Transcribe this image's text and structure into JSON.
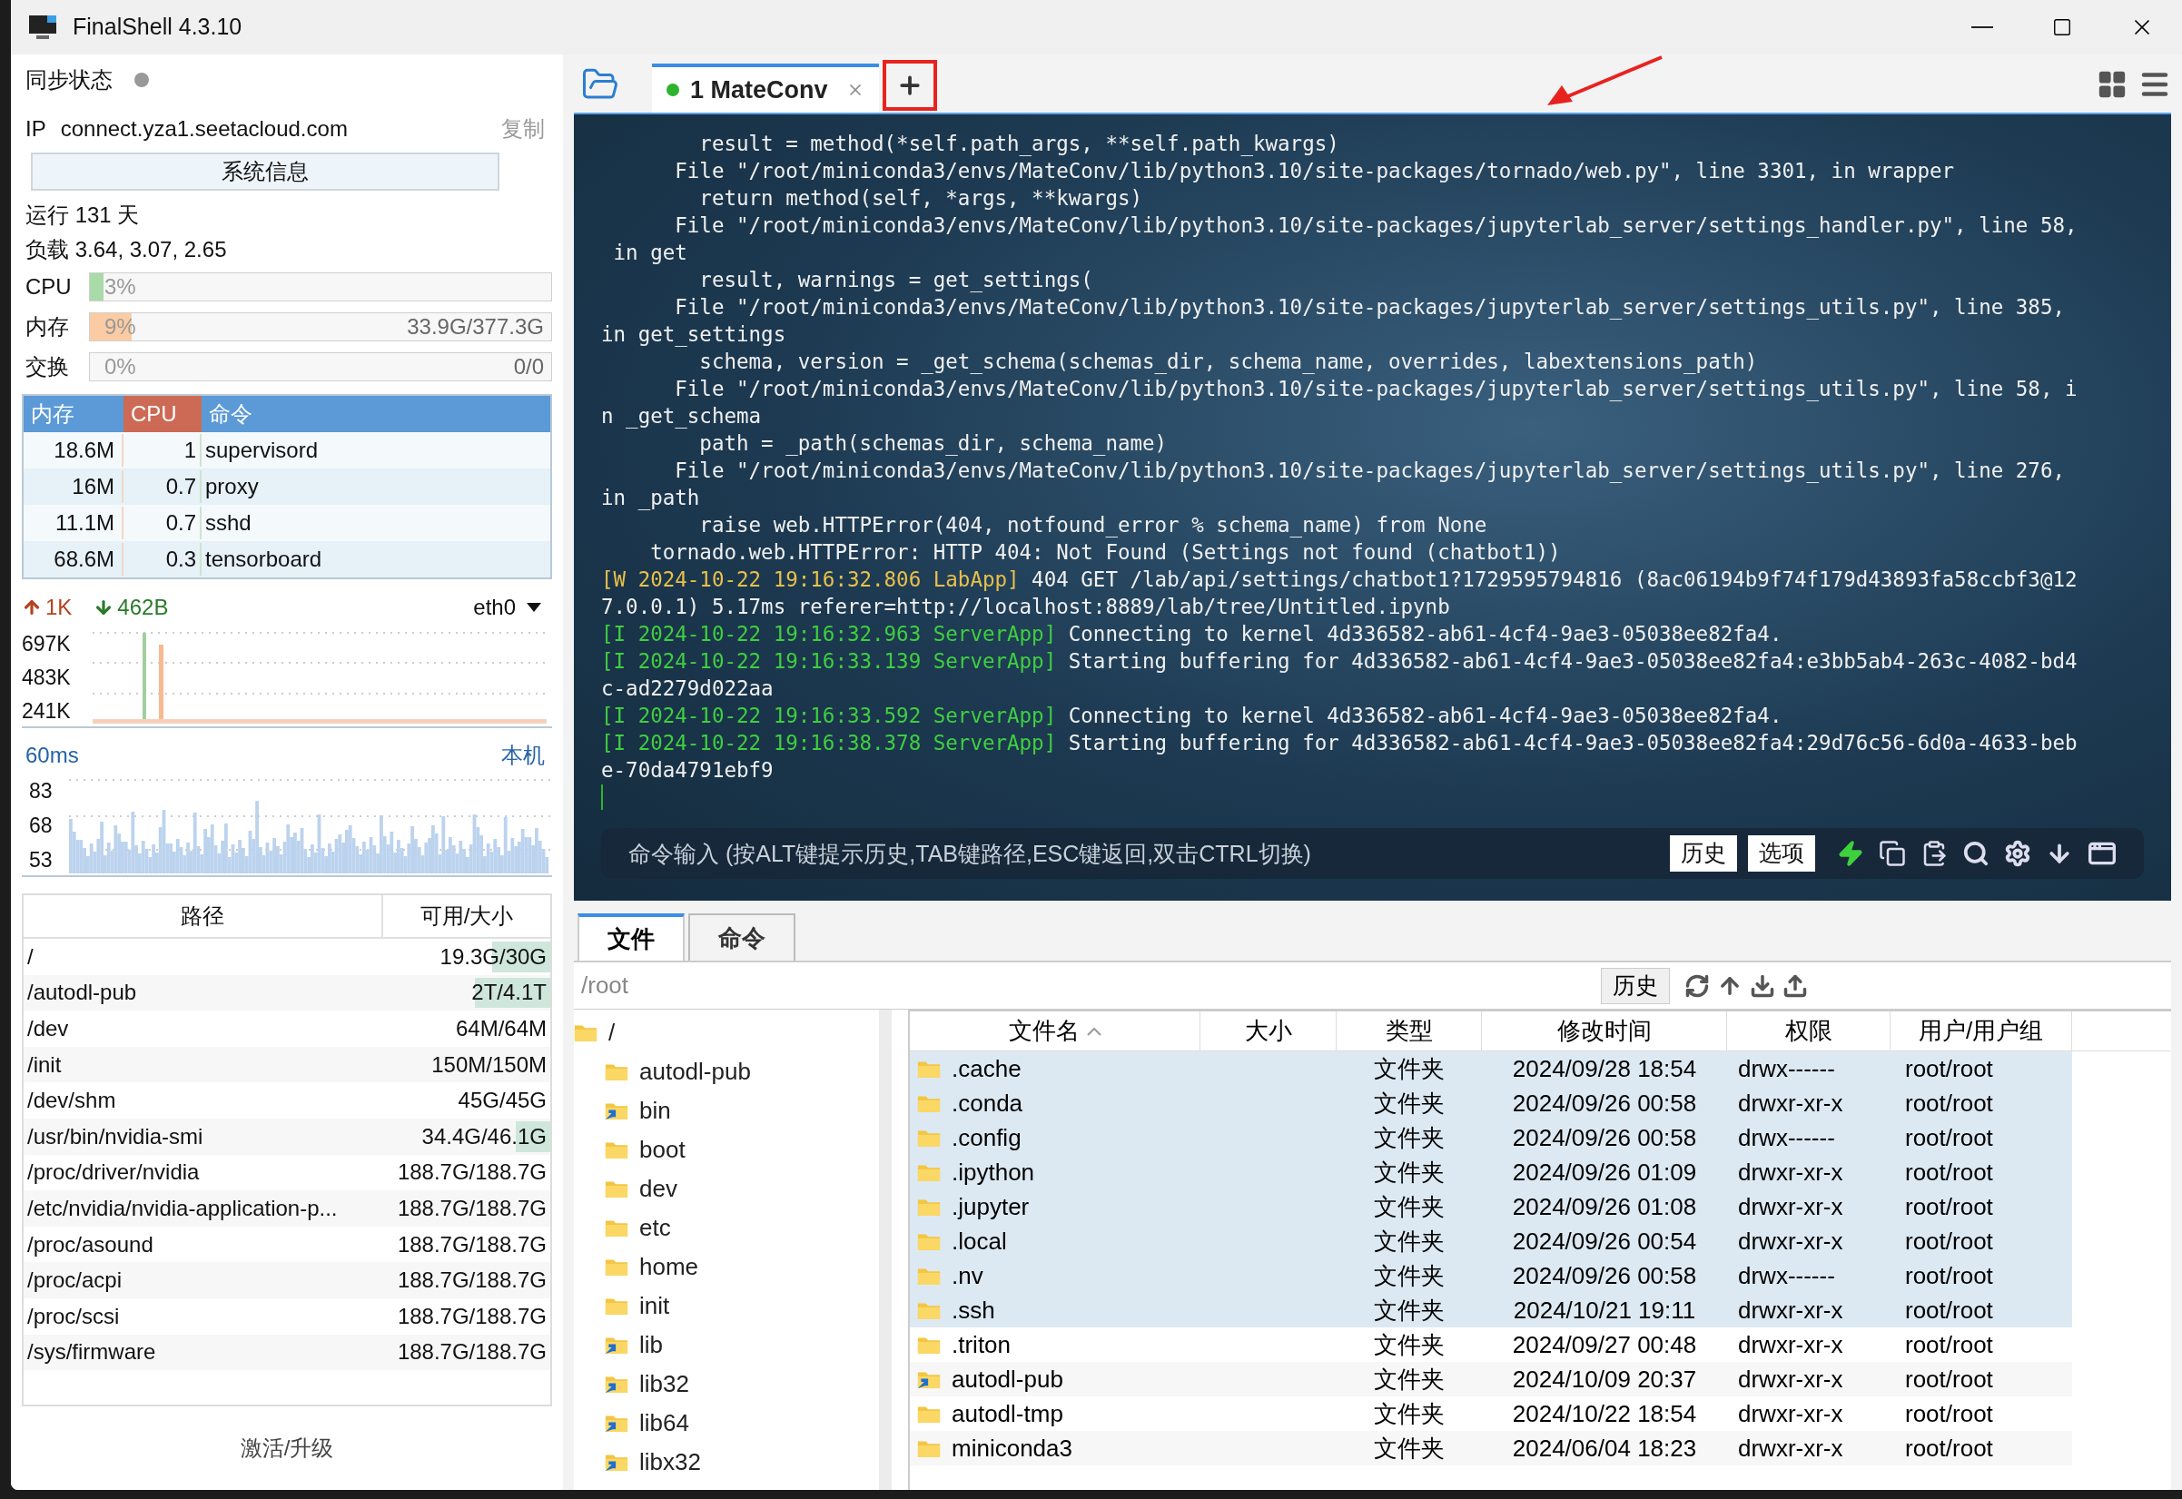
{
  "window": {
    "title": "FinalShell 4.3.10"
  },
  "sidebar": {
    "sync": {
      "label": "同步状态",
      "online": false
    },
    "ip": {
      "label": "IP",
      "value": "connect.yza1.seetacloud.com",
      "copy": "复制"
    },
    "sysinfo_button": "系统信息",
    "uptime": "运行 131 天",
    "load": "负载 3.64, 3.07, 2.65",
    "meters": [
      {
        "label": "CPU",
        "reading": "3%",
        "level": 0.03,
        "color": "#a8dba8"
      },
      {
        "label": "内存",
        "reading": "9%",
        "detail": "33.9G/377.3G",
        "level": 0.09,
        "color": "#fbcca4"
      },
      {
        "label": "交换",
        "reading": "0%",
        "detail": "0/0"
      }
    ],
    "processes": {
      "columns": [
        {
          "label": "内存",
          "selected": false
        },
        {
          "label": "CPU",
          "selected": true
        },
        {
          "label": "命令",
          "selected": false
        }
      ],
      "rows": [
        [
          "18.6M",
          "1",
          "supervisord"
        ],
        [
          "16M",
          "0.7",
          "proxy"
        ],
        [
          "11.1M",
          "0.7",
          "sshd"
        ],
        [
          "68.6M",
          "0.3",
          "tensorboard"
        ]
      ]
    },
    "network": {
      "up": "1K",
      "down": "462B",
      "interface": "eth0",
      "ticks": [
        "697K",
        "483K",
        "241K"
      ]
    },
    "latency": {
      "reading": "60ms",
      "target": "本机",
      "ticks": [
        "83",
        "68",
        "53"
      ]
    },
    "disks": {
      "columns": [
        "路径",
        "可用/大小"
      ],
      "rows": [
        {
          "path": "/",
          "size": "19.3G/30G",
          "level": 0.34
        },
        {
          "path": "/autodl-pub",
          "size": "2T/4.1T",
          "level": 0.44
        },
        {
          "path": "/dev",
          "size": "64M/64M"
        },
        {
          "path": "/init",
          "size": "150M/150M"
        },
        {
          "path": "/dev/shm",
          "size": "45G/45G"
        },
        {
          "path": "/usr/bin/nvidia-smi",
          "size": "34.4G/46.1G",
          "level": 0.2
        },
        {
          "path": "/proc/driver/nvidia",
          "size": "188.7G/188.7G"
        },
        {
          "path": "/etc/nvidia/nvidia-application-p...",
          "size": "188.7G/188.7G"
        },
        {
          "path": "/proc/asound",
          "size": "188.7G/188.7G"
        },
        {
          "path": "/proc/acpi",
          "size": "188.7G/188.7G"
        },
        {
          "path": "/proc/scsi",
          "size": "188.7G/188.7G"
        },
        {
          "path": "/sys/firmware",
          "size": "188.7G/188.7G"
        }
      ]
    },
    "activate": "激活/升级"
  },
  "tabs": [
    {
      "label": "1 MateConv",
      "connected": true,
      "selected": true
    }
  ],
  "terminal": {
    "lines": [
      {
        "text": "        result = method(*self.path_args, **self.path_kwargs)"
      },
      {
        "text": "      File \"/root/miniconda3/envs/MateConv/lib/python3.10/site-packages/tornado/web.py\", line 3301, in wrapper"
      },
      {
        "text": "        return method(self, *args, **kwargs)"
      },
      {
        "text": "      File \"/root/miniconda3/envs/MateConv/lib/python3.10/site-packages/jupyterlab_server/settings_handler.py\", line 58,"
      },
      {
        "text": " in get"
      },
      {
        "text": "        result, warnings = get_settings("
      },
      {
        "text": "      File \"/root/miniconda3/envs/MateConv/lib/python3.10/site-packages/jupyterlab_server/settings_utils.py\", line 385,"
      },
      {
        "text": "in get_settings"
      },
      {
        "text": "        schema, version = _get_schema(schemas_dir, schema_name, overrides, labextensions_path)"
      },
      {
        "text": "      File \"/root/miniconda3/envs/MateConv/lib/python3.10/site-packages/jupyterlab_server/settings_utils.py\", line 58, i"
      },
      {
        "text": "n _get_schema"
      },
      {
        "text": "        path = _path(schemas_dir, schema_name)"
      },
      {
        "text": "      File \"/root/miniconda3/envs/MateConv/lib/python3.10/site-packages/jupyterlab_server/settings_utils.py\", line 276,"
      },
      {
        "text": "in _path"
      },
      {
        "text": "        raise web.HTTPError(404, notfound_error % schema_name) from None"
      },
      {
        "text": "    tornado.web.HTTPError: HTTP 404: Not Found (Settings not found (chatbot1))"
      },
      {
        "prefix": "[W 2024-10-22 19:16:32.806 LabApp]",
        "kind": "warn",
        "text": " 404 GET /lab/api/settings/chatbot1?1729595794816 (8ac06194b9f74f179d43893fa58ccbf3@12"
      },
      {
        "text": "7.0.0.1) 5.17ms referer=http://localhost:8889/lab/tree/Untitled.ipynb"
      },
      {
        "prefix": "[I 2024-10-22 19:16:32.963 ServerApp]",
        "kind": "info",
        "text": " Connecting to kernel 4d336582-ab61-4cf4-9ae3-05038ee82fa4."
      },
      {
        "prefix": "[I 2024-10-22 19:16:33.139 ServerApp]",
        "kind": "info",
        "text": " Starting buffering for 4d336582-ab61-4cf4-9ae3-05038ee82fa4:e3bb5ab4-263c-4082-bd4"
      },
      {
        "text": "c-ad2279d022aa"
      },
      {
        "prefix": "[I 2024-10-22 19:16:33.592 ServerApp]",
        "kind": "info",
        "text": " Connecting to kernel 4d336582-ab61-4cf4-9ae3-05038ee82fa4."
      },
      {
        "prefix": "[I 2024-10-22 19:16:38.378 ServerApp]",
        "kind": "info",
        "text": " Starting buffering for 4d336582-ab61-4cf4-9ae3-05038ee82fa4:29d76c56-6d0a-4633-beb"
      },
      {
        "text": "e-70da4791ebf9"
      }
    ],
    "command_placeholder": "命令输入 (按ALT键提示历史,TAB键路径,ESC键返回,双击CTRL切换)",
    "buttons": [
      "历史",
      "选项"
    ]
  },
  "files": {
    "tabs": [
      {
        "label": "文件",
        "selected": true
      },
      {
        "label": "命令",
        "selected": false
      }
    ],
    "path": "/root",
    "history_button": "历史",
    "tree": [
      {
        "label": "/",
        "children": [
          {
            "label": "autodl-pub",
            "kind": "folder"
          },
          {
            "label": "bin",
            "kind": "link"
          },
          {
            "label": "boot",
            "kind": "folder"
          },
          {
            "label": "dev",
            "kind": "folder"
          },
          {
            "label": "etc",
            "kind": "folder"
          },
          {
            "label": "home",
            "kind": "folder"
          },
          {
            "label": "init",
            "kind": "folder"
          },
          {
            "label": "lib",
            "kind": "link"
          },
          {
            "label": "lib32",
            "kind": "link"
          },
          {
            "label": "lib64",
            "kind": "link"
          },
          {
            "label": "libx32",
            "kind": "link"
          }
        ]
      }
    ],
    "columns": [
      {
        "label": "文件名",
        "sorted": true
      },
      {
        "label": "大小",
        "sorted": false
      },
      {
        "label": "类型",
        "sorted": false
      },
      {
        "label": "修改时间",
        "sorted": false
      },
      {
        "label": "权限",
        "sorted": false
      },
      {
        "label": "用户/用户组",
        "sorted": false
      }
    ],
    "rows": [
      {
        "name": ".cache",
        "kind": "folder",
        "type": "文件夹",
        "modified": "2024/09/28 18:54",
        "perms": "drwx------",
        "owner": "root/root",
        "selected": true
      },
      {
        "name": ".conda",
        "kind": "folder",
        "type": "文件夹",
        "modified": "2024/09/26 00:58",
        "perms": "drwxr-xr-x",
        "owner": "root/root",
        "selected": true
      },
      {
        "name": ".config",
        "kind": "folder",
        "type": "文件夹",
        "modified": "2024/09/26 00:58",
        "perms": "drwx------",
        "owner": "root/root",
        "selected": true
      },
      {
        "name": ".ipython",
        "kind": "folder",
        "type": "文件夹",
        "modified": "2024/09/26 01:09",
        "perms": "drwxr-xr-x",
        "owner": "root/root",
        "selected": true
      },
      {
        "name": ".jupyter",
        "kind": "folder",
        "type": "文件夹",
        "modified": "2024/09/26 01:08",
        "perms": "drwxr-xr-x",
        "owner": "root/root",
        "selected": true
      },
      {
        "name": ".local",
        "kind": "folder",
        "type": "文件夹",
        "modified": "2024/09/26 00:54",
        "perms": "drwxr-xr-x",
        "owner": "root/root",
        "selected": true
      },
      {
        "name": ".nv",
        "kind": "folder",
        "type": "文件夹",
        "modified": "2024/09/26 00:58",
        "perms": "drwx------",
        "owner": "root/root",
        "selected": true
      },
      {
        "name": ".ssh",
        "kind": "folder",
        "type": "文件夹",
        "modified": "2024/10/21 19:11",
        "perms": "drwxr-xr-x",
        "owner": "root/root",
        "selected": true
      },
      {
        "name": ".triton",
        "kind": "folder",
        "type": "文件夹",
        "modified": "2024/09/27 00:48",
        "perms": "drwxr-xr-x",
        "owner": "root/root",
        "selected": false
      },
      {
        "name": "autodl-pub",
        "kind": "link",
        "type": "文件夹",
        "modified": "2024/10/09 20:37",
        "perms": "drwxr-xr-x",
        "owner": "root/root",
        "selected": false
      },
      {
        "name": "autodl-tmp",
        "kind": "folder",
        "type": "文件夹",
        "modified": "2024/10/22 18:54",
        "perms": "drwxr-xr-x",
        "owner": "root/root",
        "selected": false
      },
      {
        "name": "miniconda3",
        "kind": "folder",
        "type": "文件夹",
        "modified": "2024/06/04 18:23",
        "perms": "drwxr-xr-x",
        "owner": "root/root",
        "selected": false
      }
    ]
  }
}
